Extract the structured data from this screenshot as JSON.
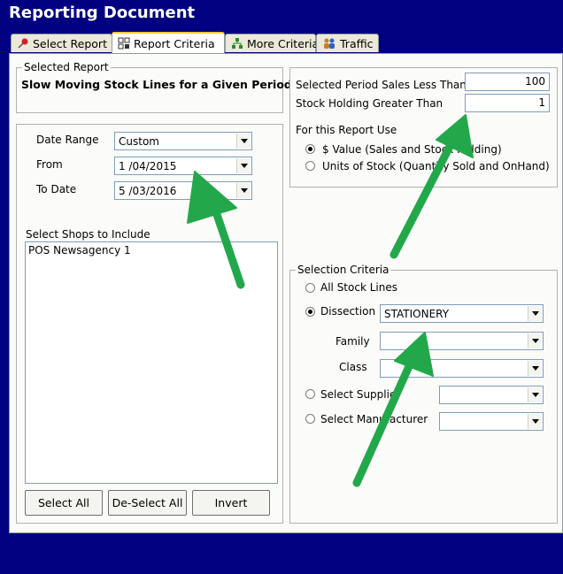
{
  "window": {
    "title": "Reporting Document"
  },
  "tabs": [
    {
      "label": "Select Report",
      "icon": "pushpin-icon"
    },
    {
      "label": "Report Criteria",
      "icon": "criteria-grid-icon"
    },
    {
      "label": "More Criteria",
      "icon": "network-icon"
    },
    {
      "label": "Traffic",
      "icon": "people-icon"
    }
  ],
  "selected_report": {
    "legend": "Selected Report",
    "name": "Slow Moving Stock Lines for a Given Period"
  },
  "dates": {
    "date_range_label": "Date Range",
    "date_range_value": "Custom",
    "from_label": "From",
    "from_value": "1 /04/2015",
    "to_label": "To Date",
    "to_value": "5 /03/2016"
  },
  "shops": {
    "label": "Select Shops to Include",
    "items": [
      "POS Newsagency 1"
    ],
    "select_all": "Select All",
    "deselect_all": "De-Select All",
    "invert": "Invert"
  },
  "thresholds": {
    "sales_label": "Selected Period Sales Less Than",
    "sales_value": "100",
    "holding_label": "Stock Holding Greater Than",
    "holding_value": "1",
    "use_label": "For this Report Use",
    "option_value": "$ Value (Sales and Stock Holding)",
    "option_units": "Units of Stock (Quantity Sold and OnHand)",
    "selected": "value"
  },
  "selection": {
    "legend": "Selection Criteria",
    "all_label": "All Stock Lines",
    "dissection_label": "Dissection",
    "dissection_value": "STATIONERY",
    "family_label": "Family",
    "family_value": "",
    "class_label": "Class",
    "class_value": "",
    "supplier_label": "Select Supplier",
    "supplier_value": "",
    "manufacturer_label": "Select Manufacturer",
    "manufacturer_value": "",
    "selected": "dissection"
  },
  "colors": {
    "window_bg": "#000080",
    "annotation_arrow": "#22a84a",
    "active_tab_accent": "#ffc83c"
  }
}
